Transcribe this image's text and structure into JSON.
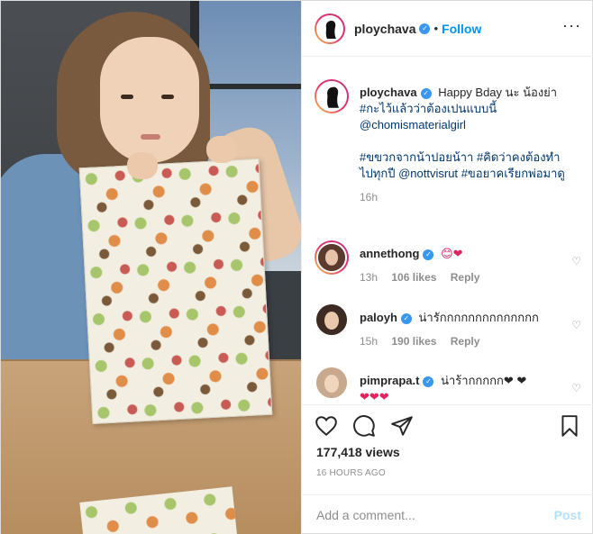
{
  "header": {
    "username": "ploychava",
    "separator": "•",
    "follow_label": "Follow",
    "more_icon": "ellipsis-icon"
  },
  "caption": {
    "username": "ploychava",
    "line1": "Happy Bday นะ น้องย่า",
    "hashtag1": "#กะไว้แล้วว่าต้องเปนแบบนี้",
    "mention1": "@chomismaterialgirl",
    "hashtag2": "#ขขวกจากน้าปอยน้าา",
    "hashtag3": "#คิดว่าคงต้องทำไปทุกปี",
    "mention2": "@nottvisrut",
    "hashtag4": "#ขอยาคเรียกพ่อมาดู",
    "time": "16h"
  },
  "comments": [
    {
      "username": "annethong",
      "text": "😊❤",
      "time": "13h",
      "likes": "106 likes",
      "reply": "Reply"
    },
    {
      "username": "paloyh",
      "text": "น่ารักกกกกกกกกกกกกก",
      "time": "15h",
      "likes": "190 likes",
      "reply": "Reply"
    },
    {
      "username": "pimprapa.t",
      "text": "น่าร้ากกกกก❤ ❤",
      "text2": "❤❤❤"
    }
  ],
  "actions": {
    "like_icon": "heart-icon",
    "comment_icon": "comment-icon",
    "share_icon": "share-icon",
    "save_icon": "bookmark-icon",
    "views": "177,418 views",
    "posted": "16 HOURS AGO"
  },
  "add_comment": {
    "placeholder": "Add a comment...",
    "post_label": "Post"
  },
  "colors": {
    "link": "#0095f6",
    "hashtag": "#00376b",
    "muted": "#8e8e8e",
    "post_disabled": "#b2dffc"
  }
}
